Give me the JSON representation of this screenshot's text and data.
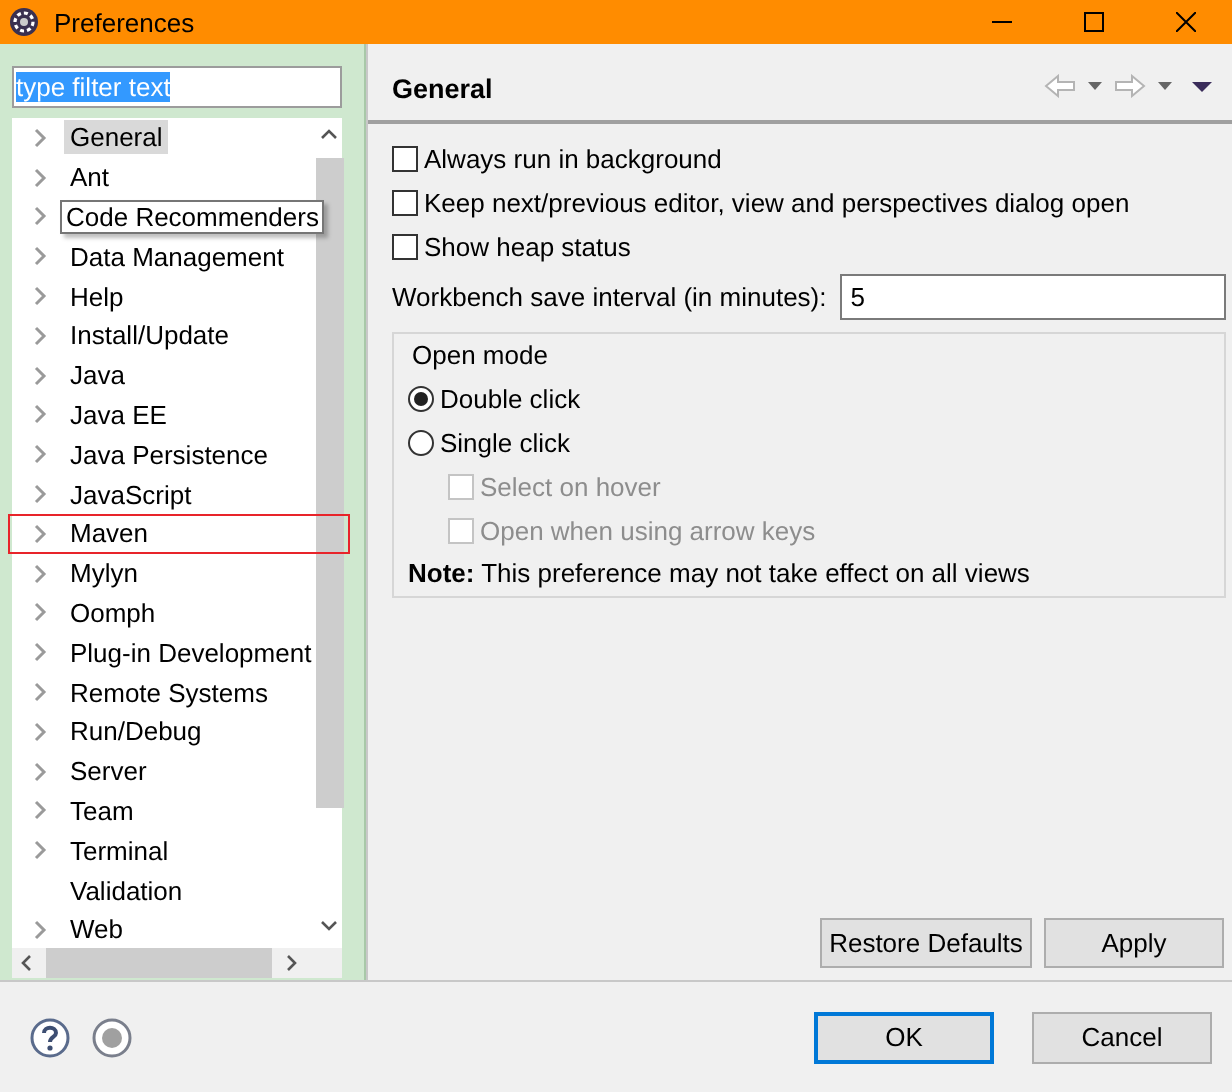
{
  "window": {
    "title": "Preferences"
  },
  "filter": {
    "value": "type filter text",
    "text_selected": true
  },
  "tree": {
    "items": [
      {
        "label": "General",
        "expandable": true,
        "selected": true,
        "tooltip": false,
        "highlighted": false
      },
      {
        "label": "Ant",
        "expandable": true,
        "selected": false,
        "tooltip": false,
        "highlighted": false
      },
      {
        "label": "Code Recommenders",
        "expandable": true,
        "selected": false,
        "tooltip": true,
        "highlighted": false
      },
      {
        "label": "Data Management",
        "expandable": true,
        "selected": false,
        "tooltip": false,
        "highlighted": false
      },
      {
        "label": "Help",
        "expandable": true,
        "selected": false,
        "tooltip": false,
        "highlighted": false
      },
      {
        "label": "Install/Update",
        "expandable": true,
        "selected": false,
        "tooltip": false,
        "highlighted": false
      },
      {
        "label": "Java",
        "expandable": true,
        "selected": false,
        "tooltip": false,
        "highlighted": false
      },
      {
        "label": "Java EE",
        "expandable": true,
        "selected": false,
        "tooltip": false,
        "highlighted": false
      },
      {
        "label": "Java Persistence",
        "expandable": true,
        "selected": false,
        "tooltip": false,
        "highlighted": false
      },
      {
        "label": "JavaScript",
        "expandable": true,
        "selected": false,
        "tooltip": false,
        "highlighted": false
      },
      {
        "label": "Maven",
        "expandable": true,
        "selected": false,
        "tooltip": false,
        "highlighted": true
      },
      {
        "label": "Mylyn",
        "expandable": true,
        "selected": false,
        "tooltip": false,
        "highlighted": false
      },
      {
        "label": "Oomph",
        "expandable": true,
        "selected": false,
        "tooltip": false,
        "highlighted": false
      },
      {
        "label": "Plug-in Development",
        "expandable": true,
        "selected": false,
        "tooltip": false,
        "highlighted": false
      },
      {
        "label": "Remote Systems",
        "expandable": true,
        "selected": false,
        "tooltip": false,
        "highlighted": false
      },
      {
        "label": "Run/Debug",
        "expandable": true,
        "selected": false,
        "tooltip": false,
        "highlighted": false
      },
      {
        "label": "Server",
        "expandable": true,
        "selected": false,
        "tooltip": false,
        "highlighted": false
      },
      {
        "label": "Team",
        "expandable": true,
        "selected": false,
        "tooltip": false,
        "highlighted": false
      },
      {
        "label": "Terminal",
        "expandable": true,
        "selected": false,
        "tooltip": false,
        "highlighted": false
      },
      {
        "label": "Validation",
        "expandable": false,
        "selected": false,
        "tooltip": false,
        "highlighted": false
      },
      {
        "label": "Web",
        "expandable": true,
        "selected": false,
        "tooltip": false,
        "highlighted": false
      }
    ]
  },
  "page": {
    "title": "General",
    "options": [
      {
        "label": "Always run in background",
        "checked": false
      },
      {
        "label": "Keep next/previous editor, view and perspectives dialog open",
        "checked": false
      },
      {
        "label": "Show heap status",
        "checked": false
      }
    ],
    "save_interval": {
      "label": "Workbench save interval (in minutes):",
      "value": "5"
    },
    "open_mode": {
      "title": "Open mode",
      "options": [
        {
          "label": "Double click",
          "selected": true
        },
        {
          "label": "Single click",
          "selected": false,
          "children": [
            {
              "label": "Select on hover",
              "checked": false,
              "disabled": true
            },
            {
              "label": "Open when using arrow keys",
              "checked": false,
              "disabled": true
            }
          ]
        }
      ]
    },
    "note": "**Note:** This preference may not take effect on all views",
    "buttons": [
      "Restore Defaults",
      "Apply"
    ]
  },
  "footer": {
    "buttons": [
      {
        "label": "OK",
        "default": true
      },
      {
        "label": "Cancel",
        "default": false
      }
    ]
  }
}
